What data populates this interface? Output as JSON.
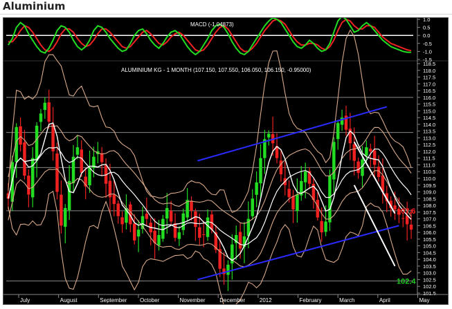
{
  "page": {
    "title": "Aluminium"
  },
  "chart_data": {
    "type": "candlestick",
    "instrument_label": "ALUMINIUM KG - 1 MONTH (107.150, 107.550, 106.050, 106.150, -0.95000)",
    "last_bar": {
      "open": 107.15,
      "high": 107.55,
      "low": 106.05,
      "close": 106.15,
      "change": -0.95
    },
    "price_axis": {
      "min": 101.5,
      "max": 118.5,
      "step": 0.5,
      "tick_labels": [
        "118.5",
        "118.0",
        "117.5",
        "117.0",
        "116.5",
        "116.0",
        "115.5",
        "115.0",
        "114.5",
        "114.0",
        "113.5",
        "113.0",
        "112.5",
        "112.0",
        "111.5",
        "111.0",
        "110.5",
        "110.0",
        "109.5",
        "109.0",
        "108.5",
        "108.0",
        "107.5",
        "107.0",
        "106.5",
        "106.0",
        "105.5",
        "105.0",
        "104.5",
        "104.0",
        "103.5",
        "103.0",
        "102.5",
        "102.0",
        "101.5"
      ]
    },
    "x_axis": {
      "labels": [
        "July",
        "August",
        "September",
        "October",
        "November",
        "December",
        "2012",
        "February",
        "March",
        "April",
        "May"
      ]
    },
    "horizontal_levels": [
      116.0,
      113.4,
      110.8,
      107.6,
      102.4
    ],
    "price_annotations": [
      {
        "text": "107.6",
        "value": 107.6,
        "color": "#ff2020"
      },
      {
        "text": "102.4",
        "value": 102.4,
        "color": "#22cc22"
      }
    ],
    "trend_lines": [
      {
        "name": "upper channel",
        "color": "#2a2aff",
        "from": [
          0.47,
          111.3
        ],
        "to": [
          0.935,
          115.3
        ]
      },
      {
        "name": "lower channel",
        "color": "#2a2aff",
        "from": [
          0.47,
          102.5
        ],
        "to": [
          0.965,
          106.5
        ]
      },
      {
        "name": "steep upper",
        "color": "#ffffff",
        "from": [
          0.855,
          112.7
        ],
        "to": [
          0.955,
          107.4
        ]
      },
      {
        "name": "steep lower",
        "color": "#ffffff",
        "from": [
          0.855,
          109.5
        ],
        "to": [
          0.955,
          103.5
        ]
      }
    ],
    "close_series": [
      108.5,
      111.2,
      113.8,
      112.5,
      110.2,
      108.8,
      111.5,
      113.9,
      114.8,
      115.6,
      114.2,
      112.0,
      109.0,
      106.5,
      107.8,
      109.8,
      111.6,
      112.3,
      110.4,
      109.4,
      110.8,
      111.6,
      112.0,
      111.2,
      109.6,
      108.6,
      108.1,
      107.2,
      106.6,
      107.8,
      106.6,
      105.4,
      106.2,
      107.2,
      107.0,
      106.0,
      105.2,
      105.8,
      107.0,
      107.8,
      106.8,
      105.6,
      106.0,
      107.4,
      108.4,
      107.6,
      106.4,
      105.6,
      105.8,
      107.1,
      106.2,
      104.7,
      103.3,
      102.9,
      103.6,
      105.1,
      105.8,
      104.8,
      105.7,
      107.0,
      108.5,
      109.7,
      111.5,
      112.9,
      113.3,
      112.6,
      111.5,
      110.3,
      109.5,
      108.6,
      107.7,
      108.8,
      109.8,
      110.5,
      109.6,
      108.4,
      107.1,
      106.0,
      106.8,
      110.2,
      112.7,
      114.1,
      114.5,
      113.6,
      112.6,
      111.3,
      110.4,
      111.4,
      112.3,
      112.0,
      111.0,
      110.1,
      109.0,
      108.3,
      107.8,
      107.7,
      107.3,
      107.0,
      106.6,
      106.2
    ],
    "macd": {
      "label": "MACD (-1.04873)",
      "value": -1.04873,
      "axis": {
        "min": -1.5,
        "max": 1.0,
        "tick_labels": [
          "1.0",
          "0.5",
          "0.0",
          "-0.5",
          "-1.0",
          "-1.5"
        ]
      },
      "line_color": "#22dd22",
      "signal_color": "#ee2222",
      "macd_series": [
        -0.6,
        -0.2,
        0.5,
        0.8,
        0.6,
        0.1,
        -0.3,
        -0.7,
        -1.0,
        -1.1,
        -0.8,
        -0.3,
        0.3,
        0.6,
        0.5,
        0.2,
        -0.3,
        -0.7,
        -0.9,
        -0.7,
        -0.3,
        0.3,
        0.6,
        0.5,
        0.2,
        -0.2,
        -0.5,
        -0.8,
        -1.0,
        -0.9,
        -0.5,
        0.0,
        0.3,
        0.4,
        0.1,
        -0.3,
        -0.6,
        -0.8,
        -0.5,
        -0.1,
        0.2,
        0.3,
        0.1,
        -0.3,
        -0.7,
        -1.0,
        -1.2,
        -1.0,
        -0.6,
        -0.2,
        0.3,
        0.6,
        0.7,
        0.5,
        0.1,
        -0.4,
        -0.8,
        -1.1,
        -1.2,
        -1.0,
        -0.6,
        -0.2,
        0.2,
        0.6,
        0.9,
        1.1,
        1.0,
        0.8,
        0.4,
        0.0,
        -0.4,
        -0.7,
        -0.8,
        -0.6,
        -0.3,
        -0.5,
        -0.8,
        -1.0,
        -0.9,
        -0.5,
        0.2,
        0.9,
        1.2,
        1.0,
        0.6,
        0.2,
        0.3,
        0.6,
        0.8,
        0.6,
        0.3,
        0.0,
        -0.3,
        -0.5,
        -0.7,
        -0.8,
        -0.9,
        -1.0,
        -1.05,
        -1.05
      ],
      "signal_series": [
        -0.4,
        -0.4,
        -0.1,
        0.3,
        0.6,
        0.5,
        0.2,
        -0.2,
        -0.6,
        -0.9,
        -1.0,
        -0.8,
        -0.4,
        0.1,
        0.4,
        0.4,
        0.2,
        -0.2,
        -0.5,
        -0.7,
        -0.6,
        -0.3,
        0.1,
        0.4,
        0.4,
        0.2,
        -0.1,
        -0.4,
        -0.7,
        -0.8,
        -0.7,
        -0.4,
        -0.1,
        0.2,
        0.3,
        0.1,
        -0.2,
        -0.5,
        -0.6,
        -0.4,
        -0.1,
        0.1,
        0.2,
        0.0,
        -0.3,
        -0.6,
        -0.9,
        -1.0,
        -0.9,
        -0.6,
        -0.2,
        0.2,
        0.5,
        0.6,
        0.4,
        0.0,
        -0.4,
        -0.8,
        -1.0,
        -1.0,
        -0.8,
        -0.5,
        -0.1,
        0.3,
        0.6,
        0.9,
        1.0,
        0.9,
        0.7,
        0.3,
        -0.1,
        -0.4,
        -0.6,
        -0.6,
        -0.5,
        -0.5,
        -0.6,
        -0.8,
        -0.9,
        -0.7,
        -0.3,
        0.3,
        0.8,
        1.0,
        0.9,
        0.6,
        0.4,
        0.4,
        0.6,
        0.6,
        0.5,
        0.2,
        -0.1,
        -0.3,
        -0.5,
        -0.6,
        -0.7,
        -0.8,
        -0.9,
        -0.95
      ]
    }
  },
  "colors": {
    "background": "#000000",
    "bull": "#22dd22",
    "bear": "#ee2020",
    "level": "#8a8a8a",
    "moving_average": "#ffffff",
    "envelope": "#d9a98a",
    "axis_text": "#ffffff"
  }
}
